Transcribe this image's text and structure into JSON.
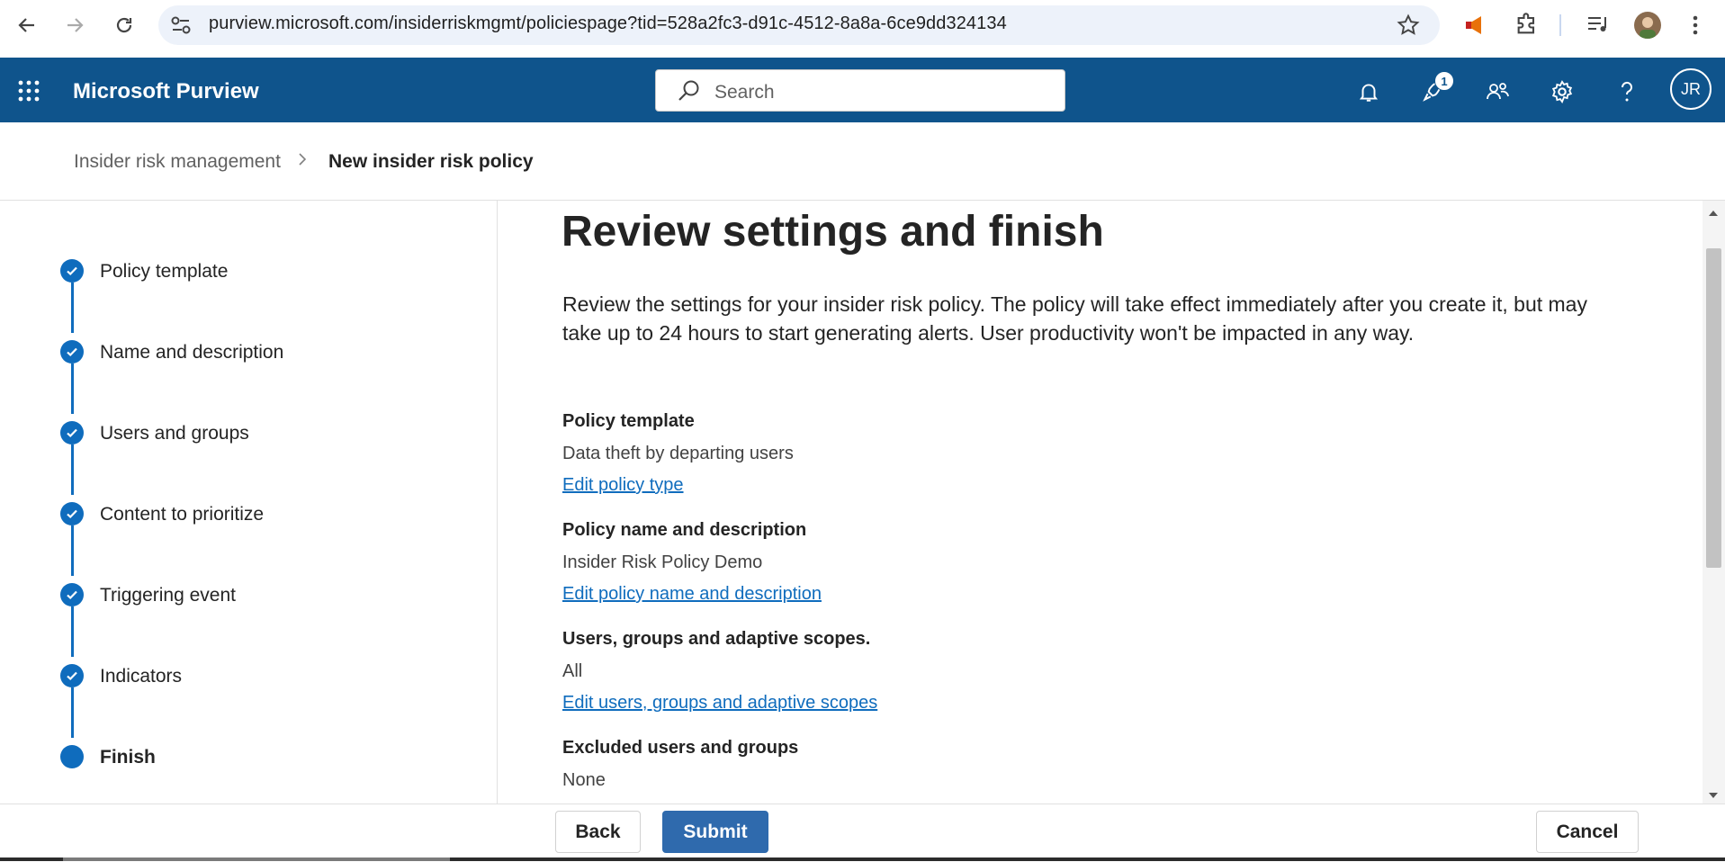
{
  "browser": {
    "url": "purview.microsoft.com/insiderriskmgmt/policiespage?tid=528a2fc3-d91c-4512-8a8a-6ce9dd324134"
  },
  "header": {
    "app_title": "Microsoft Purview",
    "search_placeholder": "Search",
    "notification_badge": "1",
    "avatar_initials": "JR"
  },
  "breadcrumb": {
    "parent": "Insider risk management",
    "separator": ">",
    "current": "New insider risk policy"
  },
  "steps": [
    {
      "label": "Policy template",
      "status": "completed"
    },
    {
      "label": "Name and description",
      "status": "completed"
    },
    {
      "label": "Users and groups",
      "status": "completed"
    },
    {
      "label": "Content to prioritize",
      "status": "completed"
    },
    {
      "label": "Triggering event",
      "status": "completed"
    },
    {
      "label": "Indicators",
      "status": "completed"
    },
    {
      "label": "Finish",
      "status": "current"
    }
  ],
  "main": {
    "title": "Review settings and finish",
    "intro": "Review the settings for your insider risk policy. The policy will take effect immediately after you create it, but may take up to 24 hours to start generating alerts. User productivity won't be impacted in any way.",
    "sections": [
      {
        "heading": "Policy template",
        "value": "Data theft by departing users",
        "link": "Edit policy type"
      },
      {
        "heading": "Policy name and description",
        "value": "Insider Risk Policy Demo",
        "link": "Edit policy name and description"
      },
      {
        "heading": "Users, groups and adaptive scopes.",
        "value": "All",
        "link": "Edit users, groups and adaptive scopes"
      },
      {
        "heading": "Excluded users and groups",
        "value": "None"
      }
    ]
  },
  "footer": {
    "back_label": "Back",
    "submit_label": "Submit",
    "cancel_label": "Cancel"
  },
  "colors": {
    "header_bg": "#0f548c",
    "accent": "#0f6cbd",
    "submit_bg": "#2f6aad"
  }
}
